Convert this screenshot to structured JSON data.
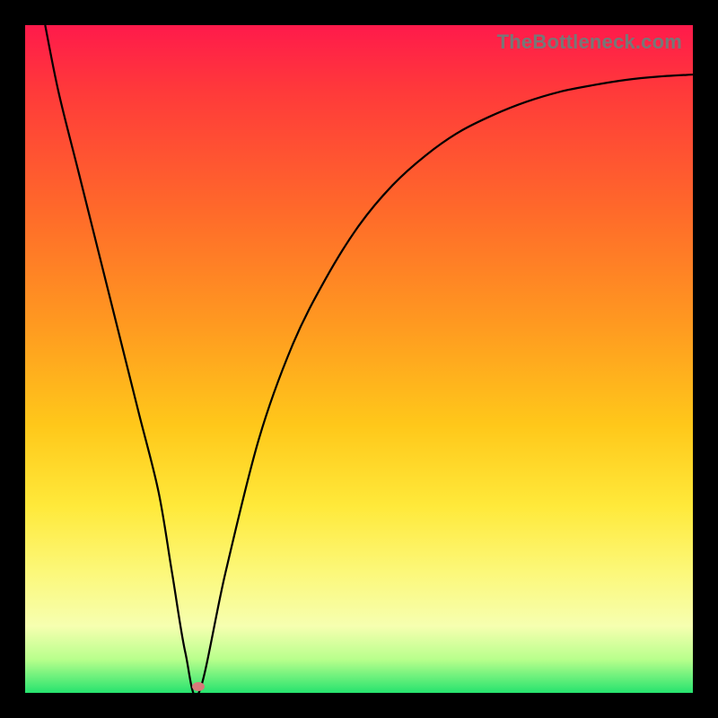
{
  "watermark": "TheBottleneck.com",
  "colors": {
    "curve": "#000000",
    "marker": "#d77a7a",
    "gradient_top": "#ff1a4b",
    "gradient_bottom": "#26e36e",
    "frame": "#000000"
  },
  "chart_data": {
    "type": "line",
    "title": "",
    "xlabel": "",
    "ylabel": "",
    "xlim": [
      0,
      100
    ],
    "ylim": [
      0,
      100
    ],
    "grid": false,
    "legend": false,
    "series": [
      {
        "name": "bottleneck-curve",
        "x": [
          3,
          5,
          8,
          11,
          14,
          17,
          20,
          22,
          24,
          26,
          30,
          35,
          40,
          45,
          50,
          55,
          60,
          65,
          70,
          75,
          80,
          85,
          90,
          95,
          100
        ],
        "y": [
          100,
          90,
          78,
          66,
          54,
          42,
          30,
          18,
          6,
          0,
          18,
          38,
          52,
          62,
          70,
          76,
          80.5,
          84,
          86.5,
          88.5,
          90,
          91,
          91.8,
          92.3,
          92.6
        ]
      }
    ],
    "annotations": [
      {
        "name": "minimum-marker",
        "x": 26,
        "y": 1
      }
    ]
  }
}
